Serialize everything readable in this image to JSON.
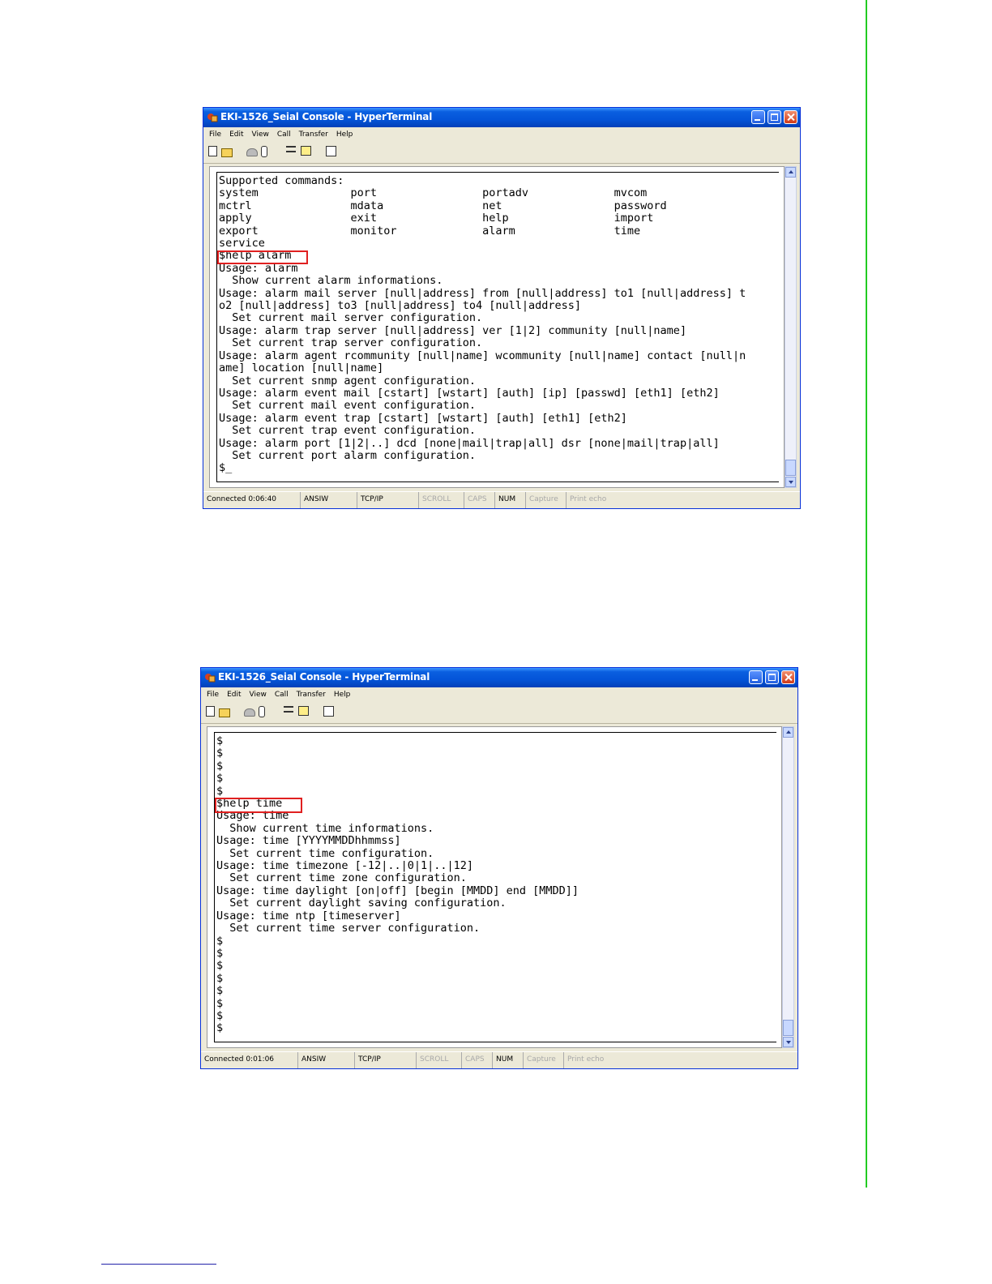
{
  "windows": [
    {
      "title": "EKI-1526_Seial Console - HyperTerminal",
      "menu": [
        "File",
        "Edit",
        "View",
        "Call",
        "Transfer",
        "Help"
      ],
      "toolbar_icons": [
        "new-connection-icon",
        "open-icon",
        "phone-icon",
        "disconnect-icon",
        "send-icon",
        "receive-icon",
        "properties-icon"
      ],
      "terminal_lines": [
        "Supported commands:",
        "system              port                portadv             mvcom",
        "mctrl               mdata               net                 password",
        "apply               exit                help                import",
        "export              monitor             alarm               time",
        "service",
        "$help alarm",
        "Usage: alarm",
        "  Show current alarm informations.",
        "Usage: alarm mail server [null|address] from [null|address] to1 [null|address] t",
        "o2 [null|address] to3 [null|address] to4 [null|address]",
        "  Set current mail server configuration.",
        "Usage: alarm trap server [null|address] ver [1|2] community [null|name]",
        "  Set current trap server configuration.",
        "Usage: alarm agent rcommunity [null|name] wcommunity [null|name] contact [null|n",
        "ame] location [null|name]",
        "  Set current snmp agent configuration.",
        "Usage: alarm event mail [cstart] [wstart] [auth] [ip] [passwd] [eth1] [eth2]",
        "  Set current mail event configuration.",
        "Usage: alarm event trap [cstart] [wstart] [auth] [eth1] [eth2]",
        "  Set current trap event configuration.",
        "Usage: alarm port [1|2|..] dcd [none|mail|trap|all] dsr [none|mail|trap|all]",
        "  Set current port alarm configuration.",
        "$_"
      ],
      "status": [
        "Connected 0:06:40",
        "ANSIW",
        "TCP/IP",
        "SCROLL",
        "CAPS",
        "NUM",
        "Capture",
        "Print echo"
      ]
    },
    {
      "title": "EKI-1526_Seial Console - HyperTerminal",
      "menu": [
        "File",
        "Edit",
        "View",
        "Call",
        "Transfer",
        "Help"
      ],
      "toolbar_icons": [
        "new-connection-icon",
        "open-icon",
        "phone-icon",
        "disconnect-icon",
        "send-icon",
        "receive-icon",
        "properties-icon"
      ],
      "terminal_lines": [
        "$",
        "$",
        "$",
        "$",
        "$",
        "$help time",
        "Usage: time",
        "  Show current time informations.",
        "Usage: time [YYYYMMDDhhmmss]",
        "  Set current time configuration.",
        "Usage: time timezone [-12|..|0|1|..|12]",
        "  Set current time zone configuration.",
        "Usage: time daylight [on|off] [begin [MMDD] end [MMDD]]",
        "  Set current daylight saving configuration.",
        "Usage: time ntp [timeserver]",
        "  Set current time server configuration.",
        "$",
        "$",
        "$",
        "$",
        "$",
        "$",
        "$",
        "$"
      ],
      "status": [
        "Connected 0:01:06",
        "ANSIW",
        "TCP/IP",
        "SCROLL",
        "CAPS",
        "NUM",
        "Capture",
        "Print echo"
      ]
    }
  ],
  "colors": {
    "highlight_box": "#e02020",
    "side_rule": "#22cc22"
  }
}
